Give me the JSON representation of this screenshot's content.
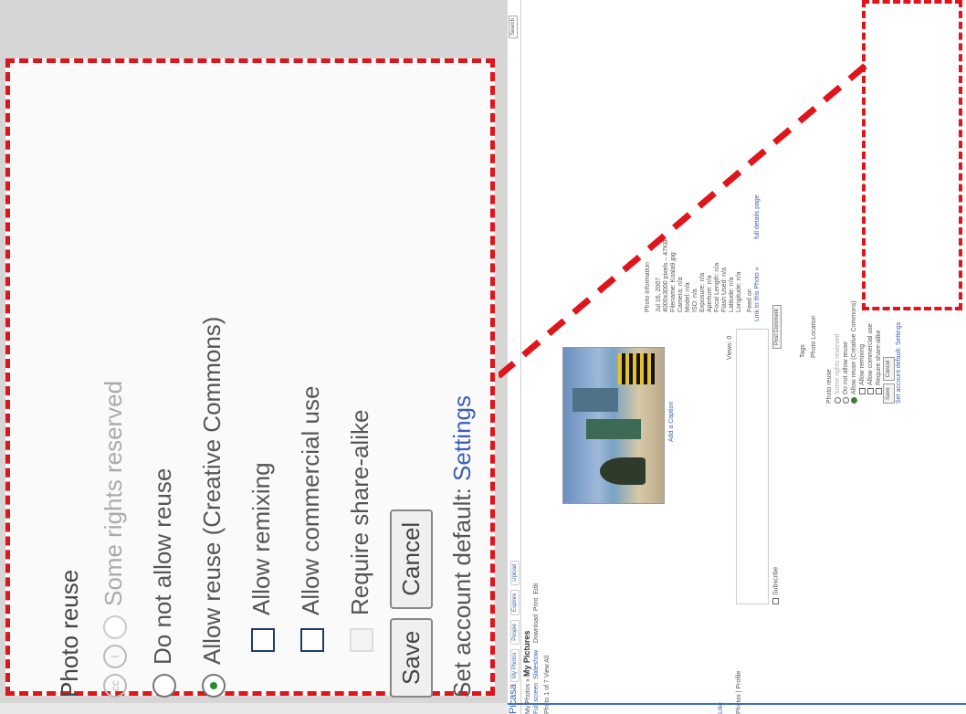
{
  "zoom": {
    "title": "Photo reuse",
    "cc_option": "Some rights reserved",
    "option_no_reuse": "Do not allow reuse",
    "option_allow": "Allow reuse (Creative Commons)",
    "chk_remix": "Allow remixing",
    "chk_commercial": "Allow commercial use",
    "chk_sharealike": "Require share-alike",
    "save": "Save",
    "cancel": "Cancel",
    "default_prefix": "Set account default:",
    "default_link": "Settings"
  },
  "shot": {
    "app": "Picasa",
    "nav": [
      "My Photos",
      "People",
      "Explore",
      "Upload"
    ],
    "crumb_prefix": "My Photos »",
    "album_title": "My Pictures",
    "actions": [
      "Full screen",
      "Slideshow"
    ],
    "meta": [
      "Download",
      "Print",
      "Edit"
    ],
    "photo_of": "Photo 1 of 7  View All",
    "caption": "Add a Caption",
    "search_btn": "Search",
    "comment_btn": "Post Comment",
    "views": "Views: 0",
    "subscribe": "Subscribe",
    "info_title": "Photo information",
    "info": [
      "Jul 16, 2007",
      "4000x3000 pixels – 47KB",
      "Filename: Koala9.jpg",
      "Camera: n/a",
      "Model: n/a",
      "ISO: n/a",
      "Exposure: n/a",
      "Aperture: n/a",
      "Focal Length: n/a",
      "Flash Used: n/a",
      "Latitude: n/a",
      "Longitude: n/a"
    ],
    "full_details": "full details page",
    "feed": "Feed on",
    "link_photo": "Link to this Photo »",
    "tags": "Tags",
    "location": "Photo Location",
    "reuse_title": "Photo reuse",
    "reuse_cc": "Some rights reserved",
    "reuse_no": "Do not allow reuse",
    "reuse_allow": "Allow reuse (Creative Commons)",
    "reuse_remix": "Allow remixing",
    "reuse_commercial": "Allow commercial use",
    "reuse_sharealike": "Require share-alike",
    "reuse_save": "Save",
    "reuse_cancel": "Cancel",
    "reuse_default": "Set account default: Settings",
    "owner": "Photos | Profile",
    "like": "Like"
  },
  "colors": {
    "callout": "#e0141b",
    "link": "#3b5fb4"
  }
}
